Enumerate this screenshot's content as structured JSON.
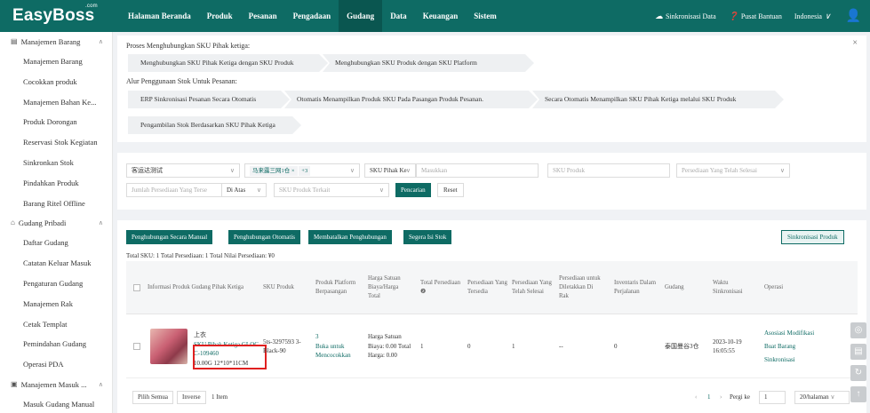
{
  "app": {
    "logo": "EasyBoss",
    "logo_sup": ".com"
  },
  "nav": [
    {
      "label": "Halaman Beranda",
      "active": false
    },
    {
      "label": "Produk",
      "active": false
    },
    {
      "label": "Pesanan",
      "active": false
    },
    {
      "label": "Pengadaan",
      "active": false
    },
    {
      "label": "Gudang",
      "active": true
    },
    {
      "label": "Data",
      "active": false
    },
    {
      "label": "Keuangan",
      "active": false
    },
    {
      "label": "Sistem",
      "active": false
    }
  ],
  "topright": {
    "sync": "Sinkronisasi Data",
    "help": "Pusat Bantuan",
    "lang": "Indonesia"
  },
  "sidebar": {
    "group1": "Manajemen Barang",
    "group1_items": [
      "Manajemen Barang",
      "Cocokkan produk",
      "Manajemen Bahan Ke...",
      "Produk Dorongan",
      "Reservasi Stok Kegiatan",
      "Sinkronkan Stok",
      "Pindahkan Produk",
      "Barang Ritel Offline"
    ],
    "group2": "Gudang Pribadi",
    "group2_items": [
      "Daftar Gudang",
      "Catatan Keluar Masuk",
      "Pengaturan Gudang",
      "Manajemen Rak",
      "Cetak Templat",
      "Pemindahan Gudang",
      "Operasi PDA"
    ],
    "group3": "Manajemen Masuk ...",
    "group3_items": [
      "Masuk Gudang Manual"
    ]
  },
  "flow": {
    "title1": "Proses Menghubungkan SKU Pihak ketiga:",
    "steps1": [
      "Menghubungkan SKU Pihak Ketiga dengan SKU Produk",
      "Menghubungkan SKU Produk dengan SKU Platform"
    ],
    "title2": "Alur Penggunaan Stok Untuk Pesanan:",
    "steps2": [
      "ERP Sinkronisasi Pesanan Secara Otomatis",
      "Otomatis Menampilkan Produk SKU Pada Pasangan Produk Pesanan.",
      "Secara Otomatis Menampilkan SKU Pihak Ketiga melalui SKU Produk"
    ],
    "steps3": [
      "Pengambilan Stok Berdasarkan SKU Pihak Ketiga"
    ],
    "close": "×"
  },
  "filters": {
    "warehouse": "客运达测试",
    "store_tag": "马来露三网1仓",
    "store_more": "+3",
    "sku_type": "SKU Pihak Ke",
    "input_placeholder": "Masukkan",
    "sku_produk_placeholder": "SKU Produk",
    "selesai_placeholder": "Persediaan Yang Telah Selesai",
    "jumlah_placeholder": "Jumlah Persediaan Yang Terse",
    "di_atas": "Di Atas",
    "sku_terkait_placeholder": "SKU Produk Terkait",
    "search_btn": "Pencarian",
    "reset_btn": "Reset"
  },
  "actions": {
    "manual": "Penghubungan Secara Manual",
    "auto": "Penghubungan Otomatis",
    "cancel": "Membatalkan Penghubungan",
    "refresh": "Segera Isi Stok",
    "sync_produk": "Sinkronisasi Produk"
  },
  "totals": "Total SKU: 1    Total Persediaan: 1    Total Nilai Persediaan: ¥0",
  "table": {
    "headers": [
      "Informasi Produk Gudang Pihak Ketiga",
      "SKU Produk",
      "Produk Platform Berpasangan",
      "Harga Satuan Biaya/Harga Total",
      "Total Persediaan ❷",
      "Persediaan Yang Tersedia",
      "Persediaan Yang Telah Selesai",
      "Persediaan untuk Diletakkan Di Rak",
      "Inventaris Dalam Perjalanan",
      "Gudang",
      "Waktu Sinkronisasi",
      "Operasi"
    ],
    "row": {
      "name": "上衣",
      "sku_line1": "SKU Pihak Ketiga GLOC",
      "sku_line2": "C-109460",
      "weight": "10.00G    12*10*11CM",
      "sku_produk": "5ts-3297593 3-Black-90",
      "platform_count": "3",
      "platform_link": "Buka untuk Mencocokkan",
      "price": "Harga Satuan Biaya: 0.00 Total Harga: 0.00",
      "total": "1",
      "tersedia": "0",
      "selesai": "1",
      "rak": "--",
      "perjalanan": "0",
      "gudang": "泰国曼谷3仓",
      "waktu": "2023-10-19 16:05:55",
      "op1": "Asosiasi Modifikasi",
      "op2": "Buat Barang",
      "op3": "Sinkronisasi"
    }
  },
  "pager": {
    "select_all": "Pilih Semua",
    "inverse": "Inverse",
    "count": "1 Item",
    "page": "1",
    "goto": "Pergi ke",
    "goto_val": "1",
    "size": "20/halaman"
  }
}
